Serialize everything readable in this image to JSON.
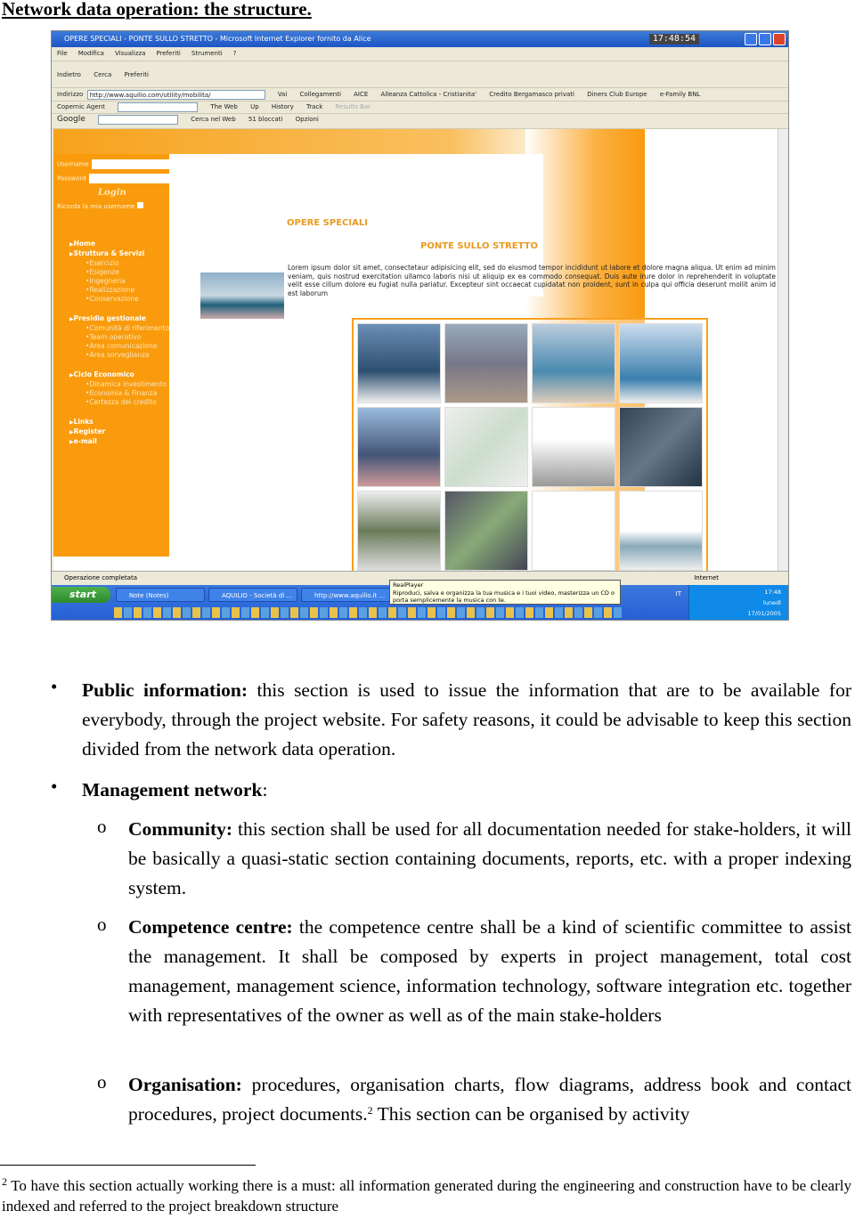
{
  "title": "Network data operation: the structure.",
  "browser": {
    "window_title": "OPERE SPECIALI - PONTE SULLO STRETTO - Microsoft Internet Explorer fornito da Alice",
    "clock": "17:48:54",
    "menu": [
      "File",
      "Modifica",
      "Visualizza",
      "Preferiti",
      "Strumenti",
      "?"
    ],
    "toolbar": [
      "Indietro",
      "Cerca",
      "Preferiti"
    ],
    "address_label": "Indirizzo",
    "address": "http://www.aquilio.com/utility/mobilita/",
    "go": "Vai",
    "links_label": "Collegamenti",
    "links": [
      "AICE",
      "Alleanza Cattolica - Cristianita'",
      "Credito Bergamasco privati",
      "Diners Club Europe",
      "e-Family BNL"
    ],
    "copernic": [
      "Copernic Agent",
      "The Web",
      "Up",
      "History",
      "Track",
      "Results Bar"
    ],
    "google": [
      "Google",
      "Cerca nel Web",
      "51 bloccati",
      "Opzioni"
    ],
    "status": "Operazione completata",
    "zone": "Internet"
  },
  "site": {
    "username": "Username",
    "password": "Password",
    "login": "Login",
    "remember": "Ricorda la mia username",
    "heading1": "OPERE SPECIALI",
    "heading2": "PONTE SULLO STRETTO",
    "lorem": "Lorem ipsum dolor sit amet, consectetaur adipisicing elit, sed do eiusmod tempor incididunt ut labore et dolore magna aliqua. Ut enim ad minim veniam, quis nostrud exercitation ullamco laboris nisi ut aliquip ex ea commodo consequat. Duis aute irure dolor in reprehenderit in voluptate velit esse cillum dolore eu fugiat nulla pariatur. Excepteur sint occaecat cupidatat non proident, sunt in culpa qui officia deserunt mollit anim id est laborum",
    "nav": [
      {
        "label": "Home",
        "type": "m"
      },
      {
        "label": "Struttura & Servizi",
        "type": "m"
      },
      {
        "label": "Esercizio",
        "type": "s"
      },
      {
        "label": "Esigenze",
        "type": "s"
      },
      {
        "label": "Ingegneria",
        "type": "s"
      },
      {
        "label": "Realizzazione",
        "type": "s"
      },
      {
        "label": "Conservazione",
        "type": "s"
      },
      {
        "label": "",
        "type": "gap"
      },
      {
        "label": "Presidio gestionale",
        "type": "m"
      },
      {
        "label": "Comunità di riferimento",
        "type": "s"
      },
      {
        "label": "Team operativo",
        "type": "s"
      },
      {
        "label": "Area comunicazione",
        "type": "s"
      },
      {
        "label": "Area sorveglianza",
        "type": "s"
      },
      {
        "label": "",
        "type": "gap"
      },
      {
        "label": "Ciclo Economico",
        "type": "m"
      },
      {
        "label": "Dinamica investimento",
        "type": "s"
      },
      {
        "label": "Economia & Finanza",
        "type": "s"
      },
      {
        "label": "Certezza del credito",
        "type": "s"
      },
      {
        "label": "",
        "type": "gap"
      },
      {
        "label": "Links",
        "type": "m"
      },
      {
        "label": "Register",
        "type": "m"
      },
      {
        "label": "e-mail",
        "type": "m"
      }
    ]
  },
  "taskbar": {
    "start": "start",
    "items": [
      "Note (Notes)",
      "AQUILIO - Società di ...",
      "http://www.aquilio.it ..."
    ],
    "tooltip_title": "RealPlayer",
    "tooltip_text": "Riproduci, salva e organizza la tua musica e i tuoi video, masterizza un CD o porta semplicemente la musica con te.",
    "lang": "IT",
    "time": "17:48",
    "day": "lunedì",
    "date": "17/01/2005"
  },
  "body": {
    "b1_head": "Public information:",
    "b1_text": " this section is used to issue the information that are to be available for everybody, through the project website. For safety reasons,  it could be advisable to keep this section divided from the network data operation.",
    "b2_head": "Management network",
    "b2_colon": ":",
    "s1_head": "Community:",
    "s1_text": " this section shall be used for all documentation needed for stake-holders, it will be basically a quasi-static section containing documents, reports, etc. with a proper indexing system.",
    "s2_head": "Competence centre:",
    "s2_text": " the competence centre shall be a kind of scientific committee to assist the management. It shall be composed by experts in project management, total cost management, management science, information technology, software integration etc. together with representatives of the owner as well as of the main stake-holders",
    "s3_head": "Organisation:",
    "s3_text": " procedures, organisation charts, flow diagrams, address book and contact procedures, project documents.",
    "s3_ref": "2",
    "s3_tail": " This section can be organised by activity",
    "bullet": "•",
    "sub_bullet": "o"
  },
  "footnote": {
    "num": "2",
    "text": " To have this section actually working there is a must: all information generated during the engineering and construction have to be clearly indexed and referred to the project breakdown structure"
  }
}
